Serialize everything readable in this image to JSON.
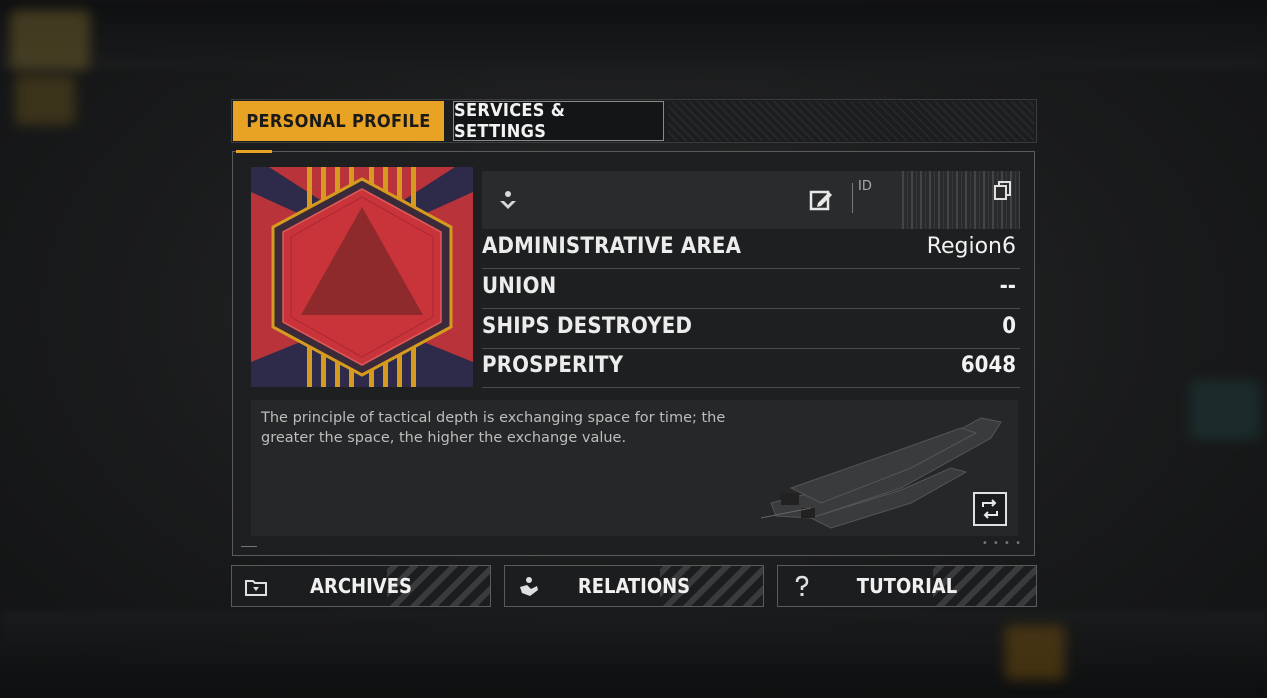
{
  "tabs": {
    "personal_profile": "PERSONAL PROFILE",
    "services_settings": "SERVICES & SETTINGS"
  },
  "profile": {
    "id_label": "ID",
    "stats": [
      {
        "label": "ADMINISTRATIVE AREA",
        "value": "Region6"
      },
      {
        "label": "UNION",
        "value": "--"
      },
      {
        "label": "SHIPS DESTROYED",
        "value": "0"
      },
      {
        "label": "PROSPERITY",
        "value": "6048"
      }
    ],
    "quote": "The principle of tactical depth is exchanging space for time; the greater the space, the higher the exchange value."
  },
  "bottom_buttons": {
    "archives": "ARCHIVES",
    "relations": "RELATIONS",
    "tutorial": "TUTORIAL"
  },
  "colors": {
    "accent": "#e9a324",
    "emblem_red": "#b9333a",
    "emblem_dark": "#2e2a4a",
    "emblem_stripe": "#d59a1e"
  },
  "icons": [
    "download-icon",
    "edit-icon",
    "copy-icon",
    "swap-icon",
    "folder-icon",
    "handshake-icon",
    "question-icon"
  ]
}
